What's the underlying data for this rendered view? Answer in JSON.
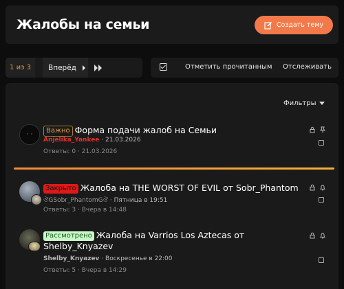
{
  "header": {
    "title": "Жалобы на семьи",
    "create_label": "Создать тему",
    "accent": "#f27a4a"
  },
  "pagination": {
    "current": "1 из 3",
    "next_label": "Вперёд"
  },
  "actions": {
    "mark_read": "Отметить прочитанным",
    "watch": "Отслеживать"
  },
  "filters_label": "Фильтры",
  "threads": [
    {
      "badge": "Важно",
      "badge_color": "#ad7a2a",
      "title": "Форма подачи жалоб на Семьи",
      "author": "Anjelika_Yankee",
      "author_color": "#e03030",
      "date": "21.03.2026",
      "stats": "Ответы: 0 · 21.03.2026"
    },
    {
      "badge": "Закрыто",
      "badge_color": "#e01818",
      "title": "Жалоба на THE WORST OF EVIL от Sobr_Phantom",
      "author": "ঔGSobr_PhantomGঔ",
      "author_color": "#9a9a9a",
      "date": "Пятница в 19:51",
      "stats": "Ответы: 3 · Вчера в 14:48"
    },
    {
      "badge": "Рассмотрено",
      "badge_color": "#c8f7c8",
      "title_line1": "Жалоба на Varrios Los Aztecas от",
      "title_line2": "Shelby_Knyazev",
      "author": "Shelby_Knyazev",
      "author_color": "#b5b5b5",
      "date": "Воскресенье в 22:00",
      "stats": "Ответы: 5 · Вчера в 14:29"
    }
  ]
}
